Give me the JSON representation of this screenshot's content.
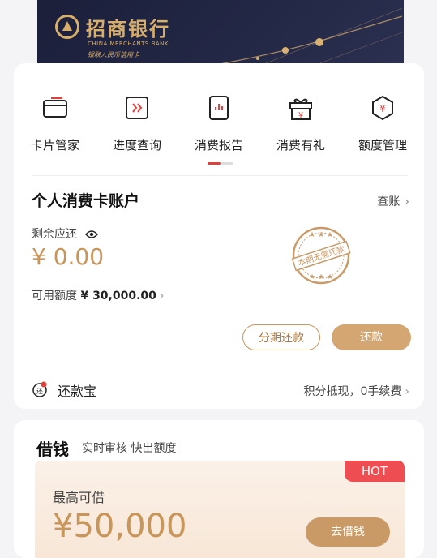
{
  "card": {
    "bank_cn": "招商银行",
    "bank_en": "CHINA MERCHANTS BANK",
    "card_type": "银联人民币信用卡"
  },
  "quick_actions": [
    {
      "label": "卡片管家",
      "icon": "card-icon"
    },
    {
      "label": "进度查询",
      "icon": "progress-arrows-icon"
    },
    {
      "label": "消费报告",
      "icon": "report-chart-icon"
    },
    {
      "label": "消费有礼",
      "icon": "gift-icon"
    },
    {
      "label": "额度管理",
      "icon": "limit-shield-icon"
    }
  ],
  "account": {
    "title": "个人消费卡账户",
    "view_bill": "查账",
    "remaining_label": "剩余应还",
    "remaining_amount": "¥ 0.00",
    "available_label": "可用额度",
    "available_amount": "¥ 30,000.00",
    "stamp_text": "本期无需还款",
    "installment_button": "分期还款",
    "repay_button": "还款"
  },
  "huankuanbao": {
    "label": "还款宝",
    "promo": "积分抵现，0手续费"
  },
  "borrow": {
    "title": "借钱",
    "subtitle": "实时审核 快出额度",
    "badge": "HOT",
    "max_label": "最高可借",
    "max_amount": "¥50,000",
    "button": "去借钱"
  },
  "colors": {
    "accent_gold": "#c8955a",
    "hot_red": "#ee4d52",
    "indicator_red": "#e0403c"
  }
}
